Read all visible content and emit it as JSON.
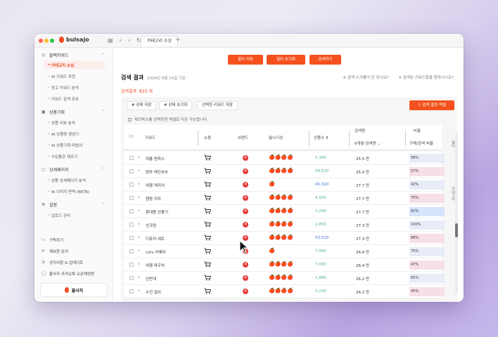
{
  "app": {
    "name": "bulsajo",
    "tab_label": "카테고리 소싱",
    "accent": "#f4511e"
  },
  "sidebar": {
    "sections": [
      {
        "label": "블랙키워드",
        "icon": "search-icon"
      },
      {
        "label": "상품기획",
        "icon": "box-icon"
      },
      {
        "label": "상세페이지",
        "icon": "page-icon"
      },
      {
        "label": "설정",
        "icon": "gear-icon"
      }
    ],
    "items": [
      "카테고리 소싱",
      "AI 키워드 추천",
      "광고 키워드 분석",
      "키워드 검색 공유",
      "상품 리뷰 분석",
      "AI 상품명 생성기",
      "AI 상품기획 마법사",
      "수입통관 제조기",
      "상품 상세페이지 분석",
      "AI 이미지 번역 (BETA)",
      "업로드 관리"
    ],
    "footer": [
      "구독하기",
      "제보환 문의",
      "공지사항 & 업데이트",
      "불사자 카카오톡 오픈채팅방"
    ],
    "bottom_button": "불사자"
  },
  "actions": {
    "save": "필터 저장",
    "reset": "필터 초기화",
    "search": "검색하기"
  },
  "results": {
    "title": "검색 결과",
    "date": "2024년 9월 14일 기준",
    "note1": "※ 검색 스크롤이 안 되나요?",
    "note2": "※ 검색된 키워드들을 원하시나요?",
    "count": "검색결과: 833 개"
  },
  "panel": {
    "btn_save_state": "# 상태 저장",
    "btn_reset_state": "# 상태 초기화",
    "btn_save_keywords": "선택한 키워드 저장",
    "btn_export": "검색 결과 엑셀",
    "hint": "체크박스를 선택하면 엑셀로 다운 가능합니다."
  },
  "table": {
    "headers": {
      "keyword": "키워드",
      "shopping": "쇼핑",
      "brand": "브랜드",
      "season": "월시기성",
      "products": "상품수",
      "volume_group": "검색량",
      "volume": "6개월 검색량",
      "ratio_group": "비율",
      "ratio": "구매/검색 비율"
    },
    "rows": [
      {
        "keyword": "여름 원피스",
        "season": "🍎🍎🍎🍎",
        "count": "1,300",
        "count_color": "green",
        "volume": "25.5 만",
        "ratio": "58%",
        "ratio_color": "blue"
      },
      {
        "keyword": "장마 레인부츠",
        "season": "🍎🍎🍎🍎",
        "count": "56,520",
        "count_color": "green",
        "volume": "25.0 만",
        "ratio": "57%",
        "ratio_color": "pink"
      },
      {
        "keyword": "여행 캐리어",
        "season": "🍎",
        "count": "40,320",
        "count_color": "blue",
        "volume": "27.7 만",
        "ratio": "42%",
        "ratio_color": "blue"
      },
      {
        "keyword": "캠핑 의자",
        "season": "🍎🍎🍎🍎",
        "count": "4,930",
        "count_color": "green",
        "volume": "27.7 만",
        "ratio": "70%",
        "ratio_color": "pink"
      },
      {
        "keyword": "휴대용 선풍기",
        "season": "🍎🍎🍎🍎",
        "count": "1,240",
        "count_color": "green",
        "volume": "27.7 만",
        "ratio": "82%",
        "ratio_color": "blue2"
      },
      {
        "keyword": "선크림",
        "season": "🍎🍎🍎🍎",
        "count": "2,850",
        "count_color": "green",
        "volume": "27.3 만",
        "ratio": "100%",
        "ratio_color": "blue"
      },
      {
        "keyword": "디퓨저 세트",
        "season": "🍎🍎🍎🍎",
        "count": "53,510",
        "count_color": "blue",
        "volume": "27.3 만",
        "ratio": "88%",
        "ratio_color": "pink"
      },
      {
        "keyword": "cctv 카메라",
        "season": "🍎",
        "count": "7,060",
        "count_color": "green",
        "volume": "26.6 만",
        "ratio": "75%",
        "ratio_color": "blue"
      },
      {
        "keyword": "여행 파우치",
        "season": "🍎🍎🍎🍎",
        "count": "7,000",
        "count_color": "green",
        "volume": "26.4 만",
        "ratio": "47%",
        "ratio_color": "pink"
      },
      {
        "keyword": "선반대",
        "season": "🍎🍎🍎🍎",
        "count": "1,860",
        "count_color": "green",
        "volume": "26.2 만",
        "ratio": "65%",
        "ratio_color": "blue"
      },
      {
        "keyword": "수건 걸이",
        "season": "🍎🍎🍎🍎",
        "count": "2,230",
        "count_color": "green",
        "volume": "26.2 만",
        "ratio": "45%",
        "ratio_color": "pink"
      }
    ]
  },
  "side_tabs": [
    "필터",
    "카테고리"
  ]
}
